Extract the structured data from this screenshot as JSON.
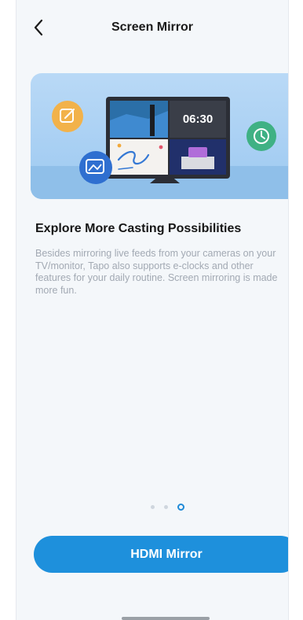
{
  "header": {
    "title": "Screen Mirror",
    "back_icon": "chevron-left-icon"
  },
  "hero": {
    "clock_time": "06:30",
    "icons": [
      "edit-icon",
      "gallery-icon",
      "clock-icon"
    ]
  },
  "content": {
    "heading": "Explore More Casting Possibilities",
    "description": "Besides mirroring live feeds from your cameras on your TV/monitor, Tapo also supports e-clocks and other features for your daily routine. Screen mirroring is made more fun."
  },
  "pagination": {
    "total": 3,
    "active": 3
  },
  "cta": {
    "label": "HDMI Mirror"
  },
  "colors": {
    "accent": "#1e90dc",
    "background": "#f4f7fa",
    "hero_bg": "#a9d0f3"
  }
}
